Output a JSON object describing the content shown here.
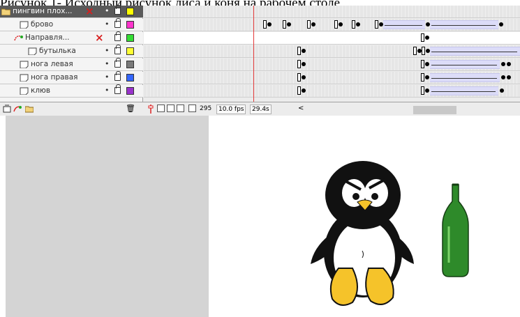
{
  "caption": "Рисунок 1- Исходный рисунок лиса и коня на рабочем столе",
  "layers": [
    {
      "name": "пингвин плох...",
      "type": "folder",
      "color": "#ffff00",
      "lock": true,
      "deleted": true
    },
    {
      "name": "брово",
      "type": "layer",
      "color": "#ff33cc",
      "lock": true
    },
    {
      "name": "Направля...",
      "type": "guide",
      "color": "#33dd33",
      "lock": true,
      "deleted": true
    },
    {
      "name": "бутылька",
      "type": "layer",
      "color": "#ffff33",
      "lock": true
    },
    {
      "name": "нога левая",
      "type": "layer",
      "color": "#7a7a7a",
      "lock": true
    },
    {
      "name": "нога правая",
      "type": "layer",
      "color": "#3366ff",
      "lock": true
    },
    {
      "name": "клюв",
      "type": "layer",
      "color": "#9933cc",
      "lock": true
    }
  ],
  "statusbar": {
    "frame": "295",
    "fps": "10.0 fps",
    "time": "29.4s",
    "scroll_left": "<"
  },
  "icons": {
    "eye": "•",
    "delete": "×",
    "trash": "🗑"
  }
}
